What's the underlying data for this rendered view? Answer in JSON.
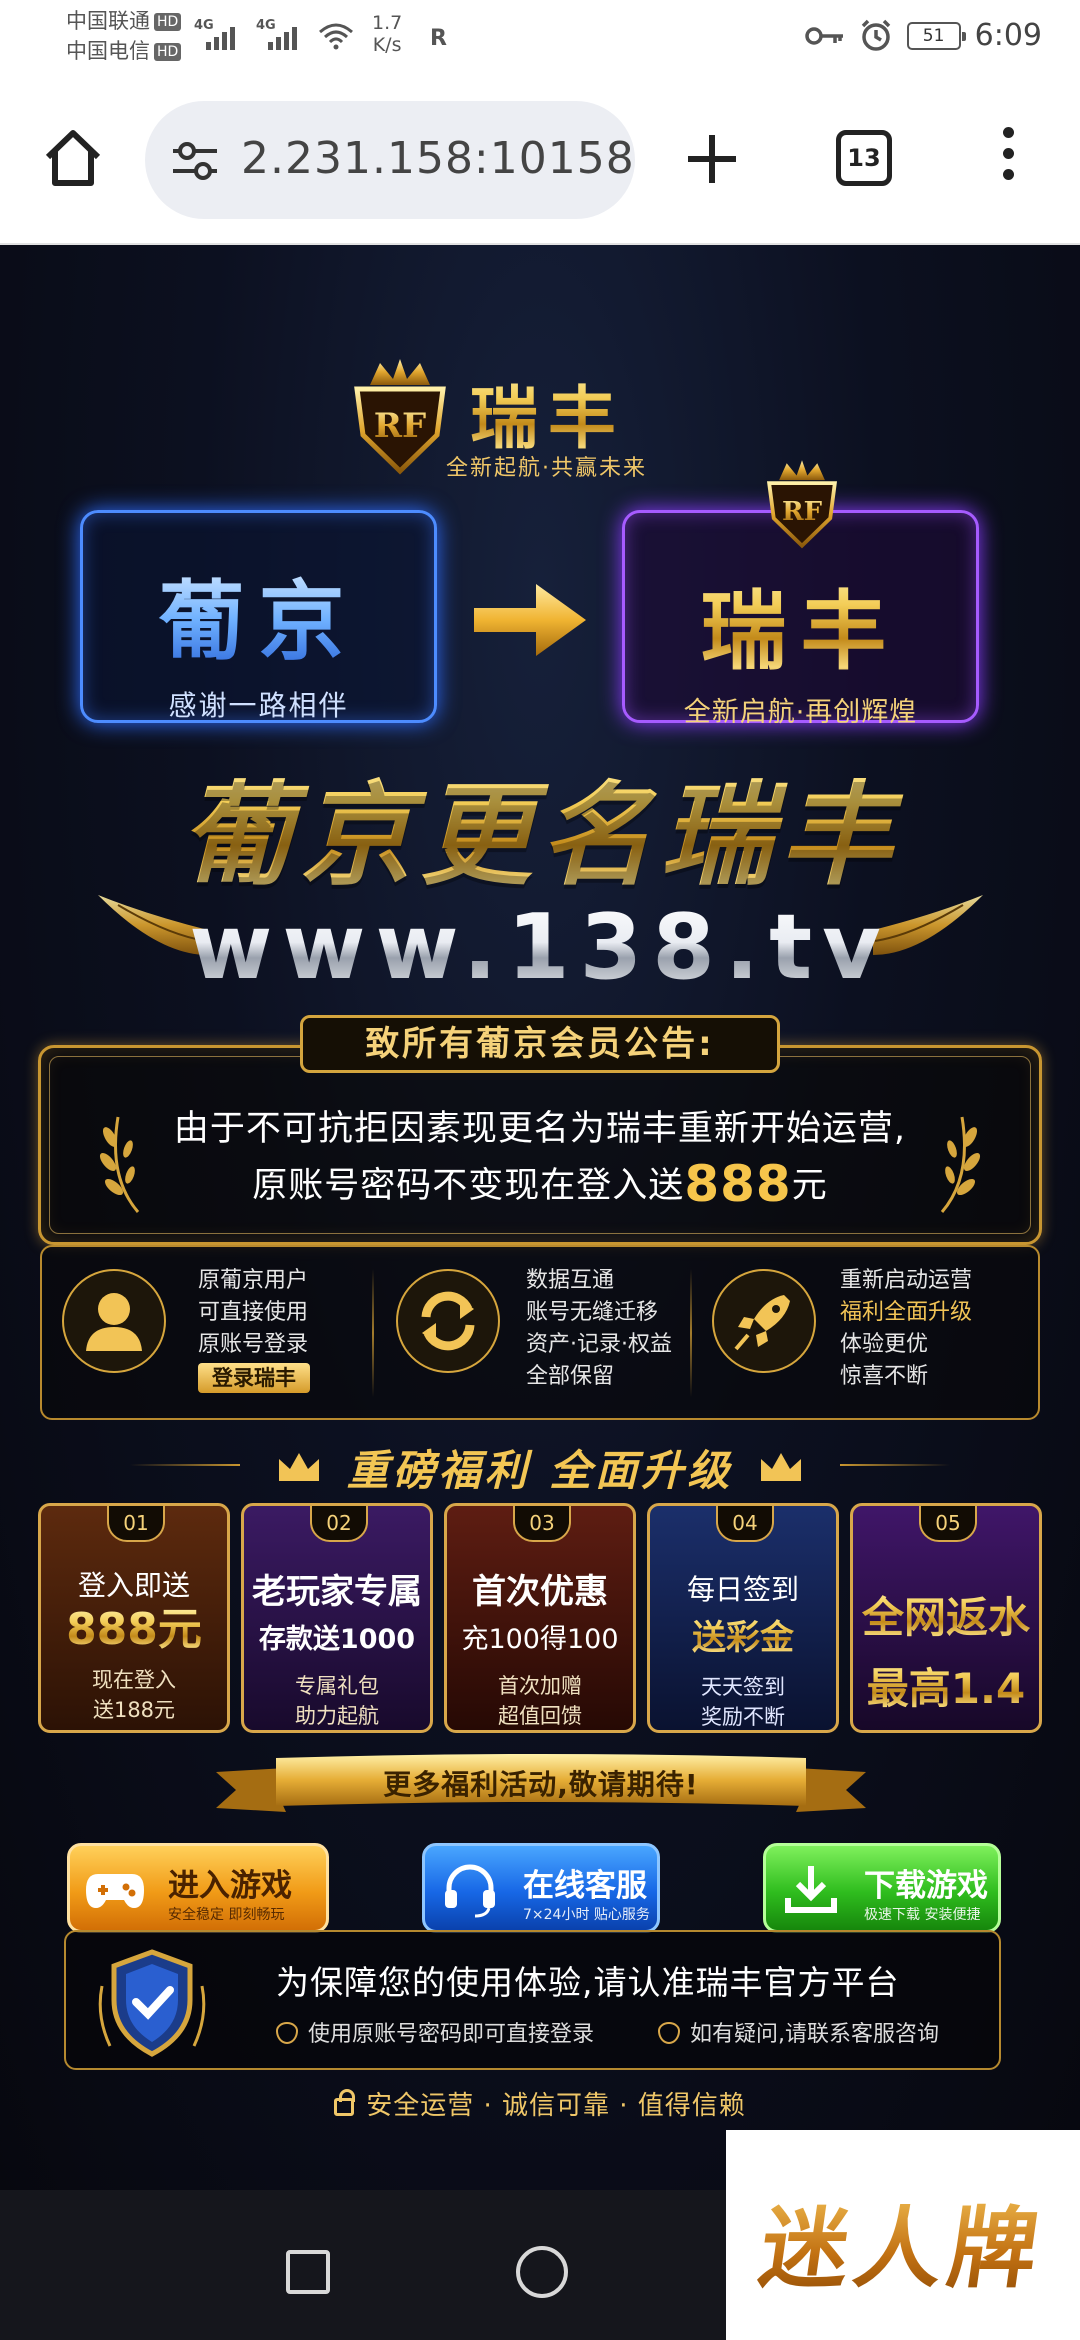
{
  "status_bar": {
    "carrier1": "中国联通",
    "carrier2": "中国电信",
    "hd": "HD",
    "net_type": "4G",
    "speed_value": "1.7",
    "speed_unit": "K/s",
    "r_icon_label": "R",
    "battery": "51",
    "time": "6:09"
  },
  "browser": {
    "url": "2.231.158:10158",
    "tab_count": "13",
    "icons": [
      "home-icon",
      "site-settings-icon",
      "new-tab-icon",
      "tab-switcher-icon",
      "more-menu-icon"
    ]
  },
  "page": {
    "brand": {
      "logo_mark": "RF",
      "name": "瑞丰",
      "slogan": "全新起航·共赢未来"
    },
    "rename": {
      "old_name": "葡京",
      "old_caption": "感谢一路相伴",
      "new_name": "瑞丰",
      "new_caption": "全新启航·再创辉煌"
    },
    "headline": "葡京更名瑞丰",
    "domain": "www.138.tv",
    "notice": {
      "title": "致所有葡京会员公告:",
      "line1": "由于不可抗拒因素现更名为瑞丰重新开始运营,",
      "line2_pre": "原账号密码不变现在登入送",
      "line2_amount": "888",
      "line2_unit": "元"
    },
    "features": [
      {
        "icon": "user-icon",
        "lines": [
          "原葡京用户",
          "可直接使用",
          "原账号登录"
        ],
        "button": "登录瑞丰"
      },
      {
        "icon": "sync-icon",
        "lines": [
          "数据互通",
          "账号无缝迁移",
          "资产·记录·权益",
          "全部保留"
        ]
      },
      {
        "icon": "rocket-icon",
        "lines": [
          "重新启动运营",
          "福利全面升级",
          "体验更优",
          "惊喜不断"
        ]
      }
    ],
    "benefit_title": "重磅福利 全面升级",
    "benefits": [
      {
        "num": "01",
        "l1": "登入即送",
        "l2": "888元",
        "l3": "现在登入",
        "l4": "送188元"
      },
      {
        "num": "02",
        "l1": "老玩家专属",
        "l2": "存款送1000",
        "l3": "专属礼包",
        "l4": "助力起航"
      },
      {
        "num": "03",
        "l1": "首次优惠",
        "l2": "充100得100",
        "l3": "首次加赠",
        "l4": "超值回馈"
      },
      {
        "num": "04",
        "l1": "每日签到",
        "l2": "送彩金",
        "l3": "天天签到",
        "l4": "奖励不断"
      },
      {
        "num": "05",
        "l1": "全网返水",
        "l2": "最高1.4",
        "l3": "",
        "l4": ""
      }
    ],
    "ribbon_text": "更多福利活动,敬请期待!",
    "buttons": {
      "game": {
        "label": "进入游戏",
        "sub": "安全稳定 即刻畅玩"
      },
      "service": {
        "label": "在线客服",
        "sub": "7×24小时 贴心服务"
      },
      "download": {
        "label": "下载游戏",
        "sub": "极速下载 安装便捷"
      }
    },
    "security": {
      "title": "为保障您的使用体验,请认准瑞丰官方平台",
      "point1": "使用原账号密码即可直接登录",
      "point2": "如有疑问,请联系客服咨询"
    },
    "footer_note": "安全运营 · 诚信可靠 · 值得信赖"
  },
  "watermark": "迷人牌",
  "colors": {
    "gold": "#f2c456",
    "blue_glow": "#4d8cff",
    "purple_glow": "#a65bff",
    "page_bg": "#0b0d16"
  }
}
